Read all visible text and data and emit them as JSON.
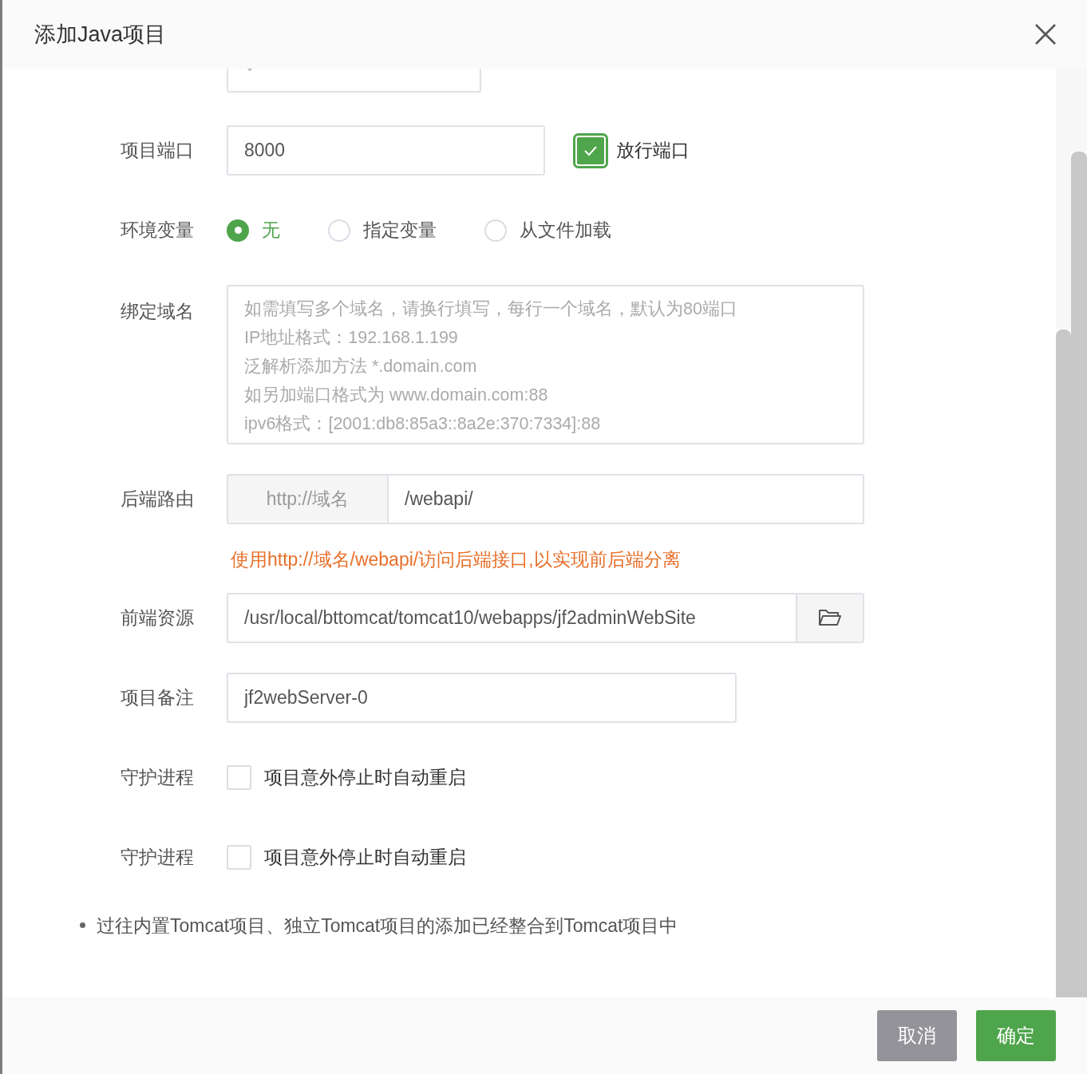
{
  "dialog": {
    "title": "添加Java项目"
  },
  "fields": [
    {
      "kind": "select"
    },
    {
      "kind": "input_check",
      "label": "项目端口",
      "value": "8000",
      "check": {
        "label": "放行端口",
        "checked": true
      }
    },
    {
      "kind": "radios",
      "label": "环境变量",
      "options": [
        {
          "label": "无",
          "selected": true
        },
        {
          "label": "指定变量",
          "selected": false
        },
        {
          "label": "从文件加载",
          "selected": false
        }
      ]
    },
    {
      "kind": "textarea",
      "label": "绑定域名",
      "placeholder": "如需填写多个域名，请换行填写，每行一个域名，默认为80端口\nIP地址格式：192.168.1.199\n泛解析添加方法 *.domain.com\n如另加端口格式为 www.domain.com:88\nipv6格式：[2001:db8:85a3::8a2e:370:7334]:88"
    },
    {
      "kind": "prefix_input",
      "label": "后端路由",
      "prefix": "http://域名",
      "value": "/webapi/"
    },
    {
      "kind": "hint",
      "text": "使用http://域名/webapi/访问后端接口,以实现前后端分离"
    },
    {
      "kind": "browse",
      "label": "前端资源",
      "value": "/usr/local/bttomcat/tomcat10/webapps/jf2adminWebSite"
    },
    {
      "kind": "input",
      "label": "项目备注",
      "value": "jf2webServer-0"
    },
    {
      "kind": "checkbox",
      "label": "守护进程",
      "text": "项目意外停止时自动重启",
      "checked": false
    },
    {
      "kind": "checkbox",
      "label": "守护进程",
      "text": "项目意外停止时自动重启",
      "checked": false
    }
  ],
  "notes": [
    "过往内置Tomcat项目、独立Tomcat项目的添加已经整合到Tomcat项目中"
  ],
  "buttons": [
    {
      "label": "取消",
      "kind": "secondary"
    },
    {
      "label": "确定",
      "kind": "primary"
    }
  ]
}
